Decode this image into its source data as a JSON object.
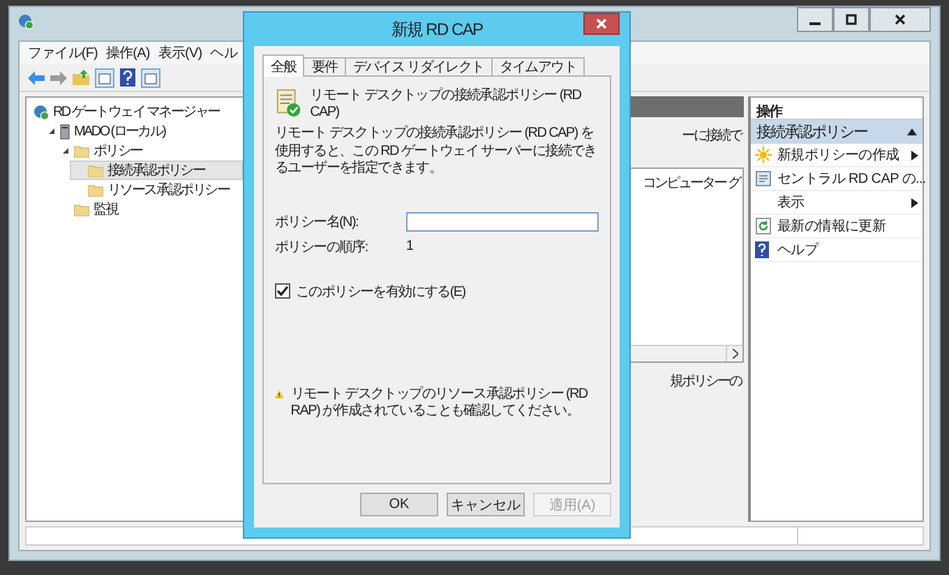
{
  "main": {
    "menu": [
      "ファイル(F)",
      "操作(A)",
      "表示(V)",
      "ヘル"
    ],
    "tree": [
      {
        "label": "RD ゲートウェイ マネージャー",
        "kind": "root",
        "selected": false,
        "children": [
          {
            "label": "MADO (ローカル)",
            "kind": "server",
            "selected": false,
            "expanded": true,
            "children": [
              {
                "label": "ポリシー",
                "kind": "folder",
                "selected": false,
                "expanded": true,
                "children": [
                  {
                    "label": "接続承認ポリシー",
                    "kind": "folder",
                    "selected": true
                  },
                  {
                    "label": "リソース承認ポリシー",
                    "kind": "folder",
                    "selected": false
                  }
                ]
              },
              {
                "label": "監視",
                "kind": "folder",
                "selected": false
              }
            ]
          }
        ]
      }
    ],
    "middle": {
      "banner_text": "ーに接続で",
      "list_cell": "コンピューター グ",
      "footer_text": "規ポリシーの"
    },
    "actions": {
      "title": "操作",
      "group": "接続承認ポリシー",
      "group_expanded": true,
      "items": [
        {
          "kind": "new",
          "label": "新規ポリシーの作成",
          "submenu": true
        },
        {
          "kind": "import",
          "label": "セントラル RD CAP の...",
          "submenu": false
        },
        {
          "kind": "view",
          "label": "表示",
          "submenu": true
        },
        {
          "kind": "refresh",
          "label": "最新の情報に更新",
          "submenu": false
        },
        {
          "kind": "help",
          "label": "ヘルプ",
          "submenu": false
        }
      ]
    }
  },
  "dialog": {
    "title": "新規 RD CAP",
    "tabs": [
      {
        "label": "全般",
        "selected": true
      },
      {
        "label": "要件",
        "selected": false
      },
      {
        "label": "デバイス リダイレクト",
        "selected": false
      },
      {
        "label": "タイムアウト",
        "selected": false
      }
    ],
    "heading": "リモート デスクトップの接続承認ポリシー (RD CAP)",
    "description": "リモート デスクトップの接続承認ポリシー (RD CAP) を使用すると、この RD ゲートウェイ サーバーに接続できるユーザーを指定できます。",
    "fields": [
      {
        "kind": "input",
        "label": "ポリシー名(N):"
      },
      {
        "kind": "value",
        "label": "ポリシーの順序:",
        "value": "1"
      }
    ],
    "checkbox": {
      "label": "このポリシーを有効にする(E)",
      "checked": true
    },
    "warning": "リモート デスクトップのリソース承認ポリシー (RD RAP) が作成されていることも確認してください。",
    "buttons": [
      {
        "label": "OK",
        "disabled": false
      },
      {
        "label": "キャンセル",
        "disabled": false
      },
      {
        "label": "適用(A)",
        "disabled": true
      }
    ]
  }
}
